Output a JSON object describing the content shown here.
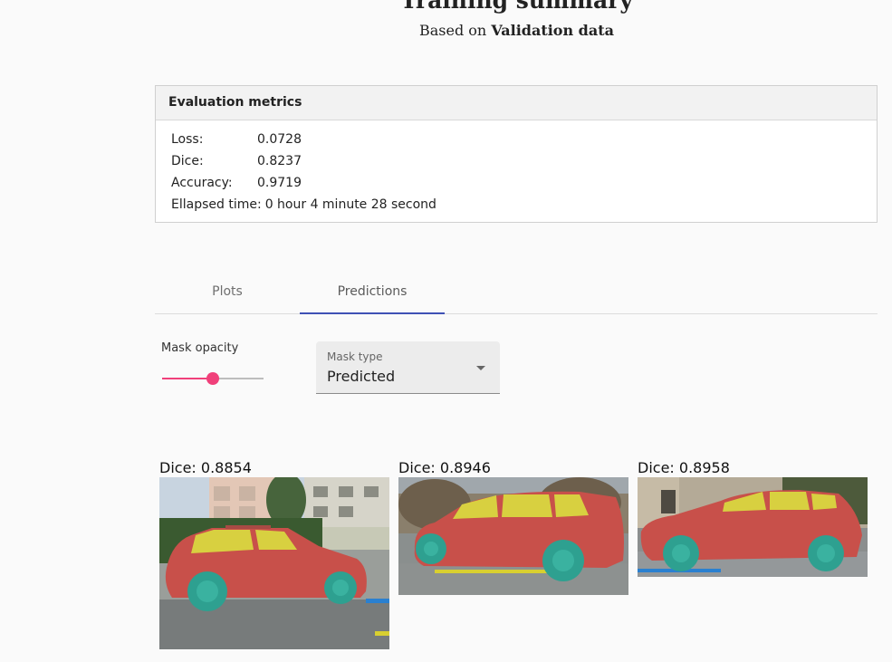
{
  "header": {
    "title": "Training summary",
    "subtitle_prefix": "Based on ",
    "subtitle_strong": "Validation data"
  },
  "metrics": {
    "heading": "Evaluation metrics",
    "rows": [
      {
        "label": "Loss:",
        "value": "0.0728"
      },
      {
        "label": "Dice:",
        "value": "0.8237"
      },
      {
        "label": "Accuracy:",
        "value": "0.9719"
      },
      {
        "label": "Ellapsed time:",
        "value": "0 hour 4 minute 28 second"
      }
    ]
  },
  "tabs": [
    {
      "label": "Plots",
      "active": false
    },
    {
      "label": "Predictions",
      "active": true
    }
  ],
  "controls": {
    "opacity_label": "Mask opacity",
    "opacity_value": 0.5,
    "mask_type_label": "Mask type",
    "mask_type_value": "Predicted"
  },
  "predictions": [
    {
      "dice_text": "Dice: 0.8854"
    },
    {
      "dice_text": "Dice: 0.8946"
    },
    {
      "dice_text": "Dice: 0.8958"
    }
  ],
  "colors": {
    "tab_indicator": "#3f51b5",
    "slider": "#f0407a",
    "body_mask": "#c8504a",
    "window_mask": "#d8d040",
    "wheel_mask": "#2ea090"
  }
}
